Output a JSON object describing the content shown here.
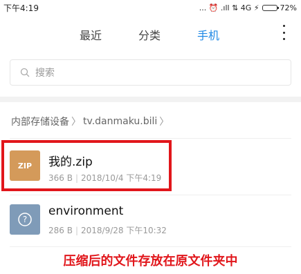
{
  "status": {
    "time": "下午4:19",
    "icons_text": "... ⏰ .ıll ⇅ 4G ⚡",
    "battery": "72%",
    "battery_level": 0.72
  },
  "tabs": [
    {
      "label": "最近",
      "active": false
    },
    {
      "label": "分类",
      "active": false
    },
    {
      "label": "手机",
      "active": true
    }
  ],
  "search": {
    "placeholder": "搜索"
  },
  "breadcrumb": {
    "root": "内部存储设备",
    "folder": "tv.danmaku.bili"
  },
  "files": [
    {
      "name": "我的.zip",
      "size": "366 B",
      "date": "2018/10/4 下午4:19",
      "icon": "zip-icon",
      "badge": "ZIP"
    },
    {
      "name": "environment",
      "size": "286 B",
      "date": "2018/9/28 下午10:32",
      "icon": "unknown-file-icon",
      "badge": "?"
    }
  ],
  "caption": "压缩后的文件存放在原文件夹中",
  "colors": {
    "accent": "#1e88e5",
    "highlight": "#e1161b",
    "zip": "#d49a5a",
    "unknown": "#7f9bb8"
  }
}
